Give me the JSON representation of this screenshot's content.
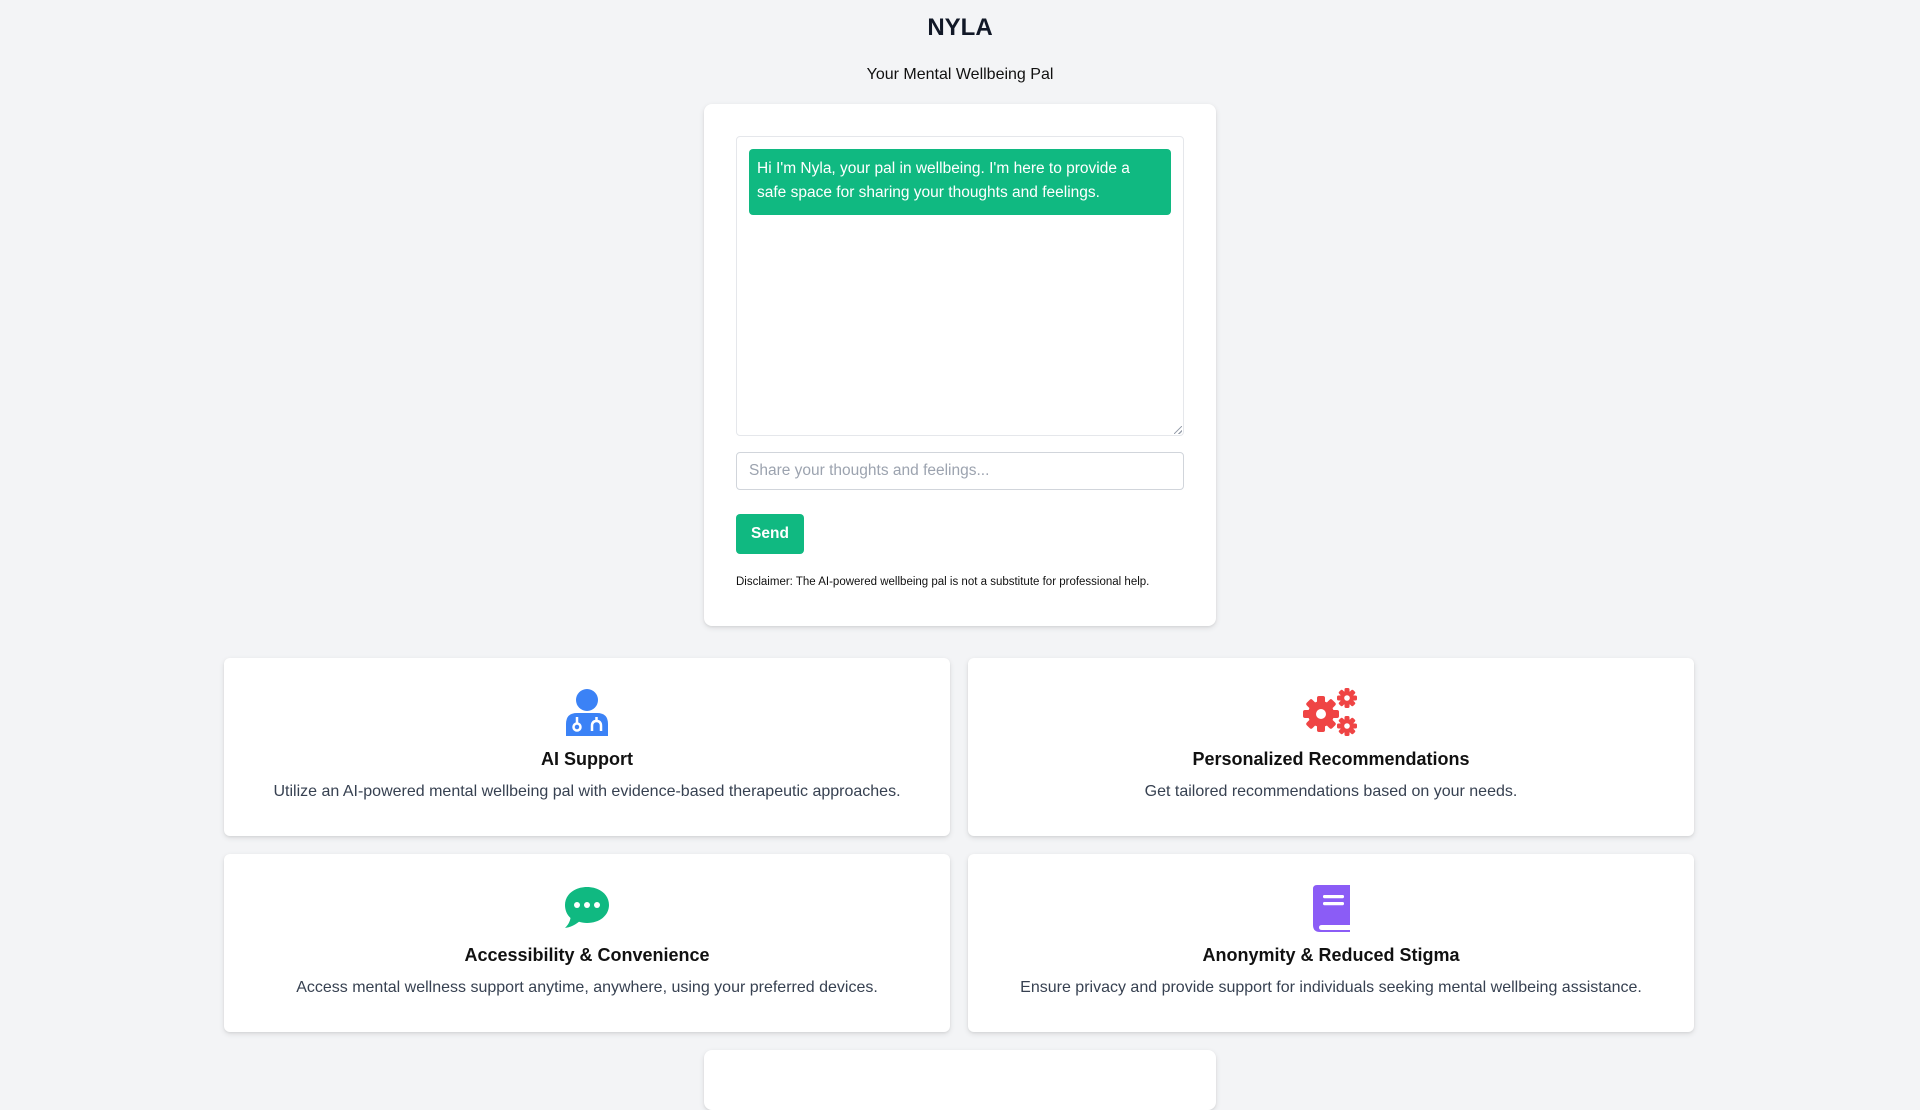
{
  "header": {
    "title": "NYLA",
    "subtitle": "Your Mental Wellbeing Pal"
  },
  "chat": {
    "messages": [
      {
        "sender": "bot",
        "text": "Hi I'm Nyla, your pal in wellbeing. I'm here to provide a safe space for sharing your thoughts and feelings."
      }
    ],
    "input_placeholder": "Share your thoughts and feelings...",
    "input_value": "",
    "send_label": "Send",
    "disclaimer": "Disclaimer: The AI-powered wellbeing pal is not a substitute for professional help."
  },
  "features": [
    {
      "icon": "doctor-icon",
      "icon_color": "#3b82f6",
      "title": "AI Support",
      "description": "Utilize an AI-powered mental wellbeing pal with evidence-based therapeutic approaches."
    },
    {
      "icon": "gears-icon",
      "icon_color": "#ef4444",
      "title": "Personalized Recommendations",
      "description": "Get tailored recommendations based on your needs."
    },
    {
      "icon": "chat-bubble-icon",
      "icon_color": "#10b981",
      "title": "Accessibility & Convenience",
      "description": "Access mental wellness support anytime, anywhere, using your preferred devices."
    },
    {
      "icon": "book-icon",
      "icon_color": "#8b5cf6",
      "title": "Anonymity & Reduced Stigma",
      "description": "Ensure privacy and provide support for individuals seeking mental wellbeing assistance."
    }
  ],
  "colors": {
    "accent": "#10b981",
    "background": "#f3f4f6"
  }
}
